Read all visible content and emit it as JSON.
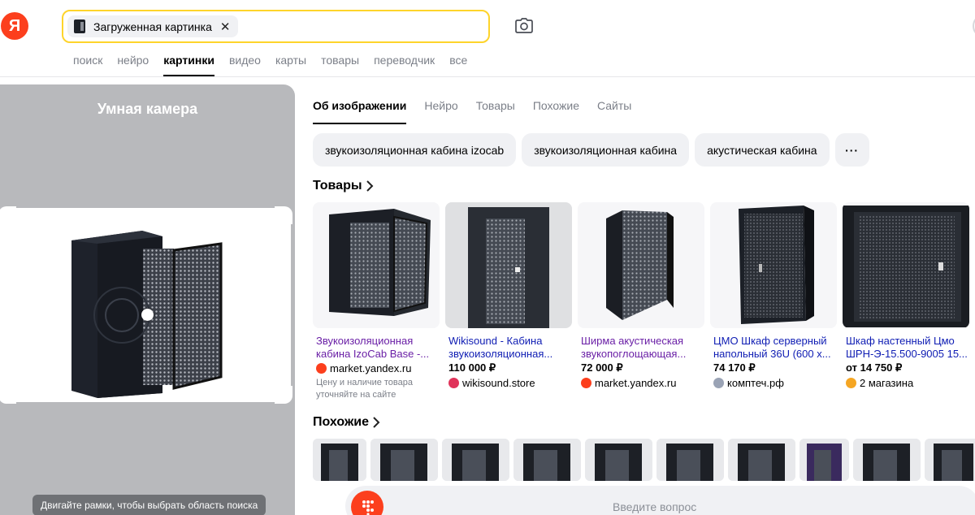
{
  "header": {
    "logo_letter": "Я",
    "search_chip_label": "Загруженная картинка",
    "chip_close": "✕",
    "camera_icon": "camera-icon"
  },
  "nav": {
    "tabs": [
      {
        "label": "поиск",
        "active": false
      },
      {
        "label": "нейро",
        "active": false
      },
      {
        "label": "картинки",
        "active": true
      },
      {
        "label": "видео",
        "active": false
      },
      {
        "label": "карты",
        "active": false
      },
      {
        "label": "товары",
        "active": false
      },
      {
        "label": "переводчик",
        "active": false
      },
      {
        "label": "все",
        "active": false
      }
    ]
  },
  "smart_camera": {
    "title": "Умная камера",
    "hint": "Двигайте рамки, чтобы выбрать область поиска"
  },
  "result_tabs": [
    {
      "label": "Об изображении",
      "active": true
    },
    {
      "label": "Нейро",
      "active": false
    },
    {
      "label": "Товары",
      "active": false
    },
    {
      "label": "Похожие",
      "active": false
    },
    {
      "label": "Сайты",
      "active": false
    }
  ],
  "query_pills": [
    "звукоизоляционная кабина izocab",
    "звукоизоляционная кабина",
    "акустическая кабина",
    "···"
  ],
  "goods": {
    "title": "Товары",
    "items": [
      {
        "title": "Звукоизоляционная кабина IzoCab Base -...",
        "price": "",
        "shop": "market.yandex.ru",
        "note": "Цену и наличие товара уточняйте на сайте",
        "visited": true,
        "shop_color": "#fc3f1d"
      },
      {
        "title": "Wikisound - Кабина звукоизоляционная...",
        "price": "110 000 ₽",
        "shop": "wikisound.store",
        "note": "",
        "visited": false,
        "shop_color": "#e0335a"
      },
      {
        "title": "Ширма акустическая звукопоглощающая...",
        "price": "72 000 ₽",
        "shop": "market.yandex.ru",
        "note": "",
        "visited": true,
        "shop_color": "#fc3f1d"
      },
      {
        "title": "ЦМО Шкаф серверный напольный 36U (600 x...",
        "price": "74 170 ₽",
        "shop": "комптеч.рф",
        "note": "",
        "visited": false,
        "shop_color": "#9aa3b5"
      },
      {
        "title": "Шкаф настенный Цмо ШРН-Э-15.500-9005 15...",
        "price": "от 14 750 ₽",
        "shop": "2 магазина",
        "note": "",
        "visited": false,
        "shop_color": "#f5a623"
      }
    ]
  },
  "similar": {
    "title": "Похожие",
    "count": 10
  },
  "ask": {
    "placeholder": "Введите вопрос"
  },
  "colors": {
    "brand_red": "#fc3f1d",
    "search_border": "#fed42b",
    "link_blue": "#0e1cb3",
    "visited_purple": "#6a1fa6"
  }
}
